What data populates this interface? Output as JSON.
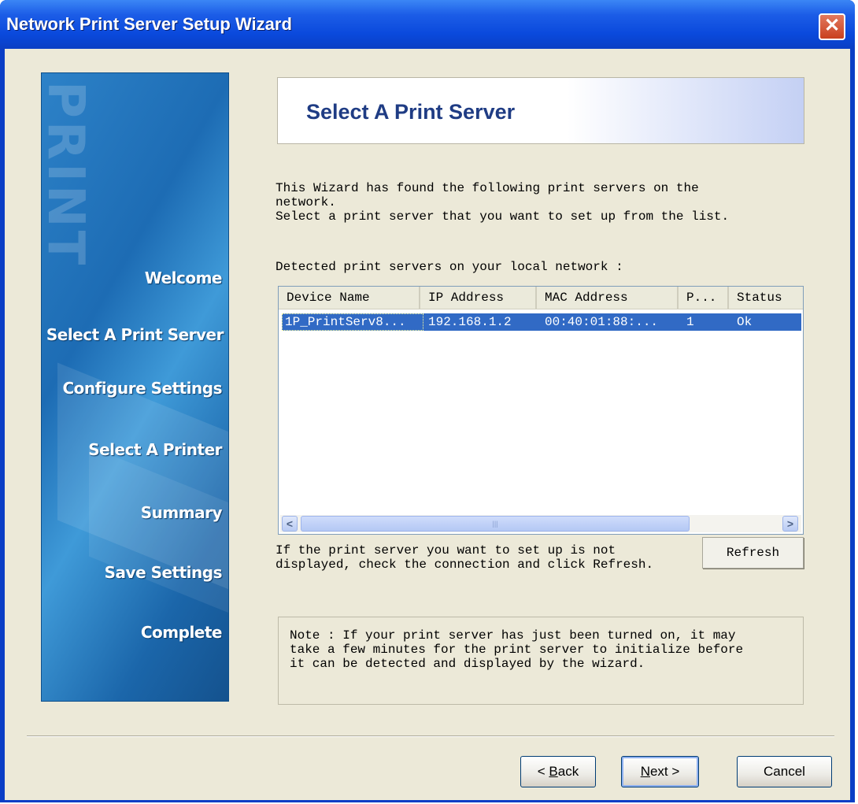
{
  "window": {
    "title": "Network Print Server Setup Wizard",
    "close_glyph": "✕"
  },
  "sidebar": {
    "watermark": "PRINT",
    "steps": [
      {
        "label": "Welcome",
        "active": false
      },
      {
        "label": "Select A Print Server",
        "active": true
      },
      {
        "label": "Configure Settings",
        "active": false
      },
      {
        "label": "Select  A  Printer",
        "active": false
      },
      {
        "label": "Summary",
        "active": false
      },
      {
        "label": "Save Settings",
        "active": false
      },
      {
        "label": "Complete",
        "active": false
      }
    ]
  },
  "header": {
    "title": "Select A Print Server"
  },
  "intro": "This Wizard has found the following print servers on the\nnetwork.\nSelect a print server that you want to set up from the list.",
  "detected_label": "Detected print servers on your local network :",
  "list": {
    "columns": [
      "Device Name",
      "IP Address",
      "MAC Address",
      "P...",
      "Status"
    ],
    "rows": [
      {
        "device_name": "1P_PrintServ8...",
        "ip": "192.168.1.2",
        "mac": "00:40:01:88:...",
        "port": "1",
        "status": "Ok",
        "selected": true
      }
    ],
    "scroll_left_icon": "scroll-left-arrow",
    "scroll_right_icon": "scroll-right-arrow"
  },
  "refresh_message": "If the print server you want to set up is not\ndisplayed, check the connection and click Refresh.",
  "refresh_label": "Refresh",
  "note": "Note : If your print server has just been turned on, it may\ntake a few minutes for the print server to initialize before\nit can be detected and displayed by the wizard.",
  "footer": {
    "back": {
      "prefix": "< ",
      "accel": "B",
      "rest": "ack"
    },
    "next": {
      "accel": "N",
      "rest": "ext >"
    },
    "cancel": "Cancel"
  },
  "colors": {
    "titlebar": "#0a49dc",
    "selection": "#316ac5",
    "dialog_bg": "#ece9d8",
    "header_title": "#1f3c84"
  }
}
